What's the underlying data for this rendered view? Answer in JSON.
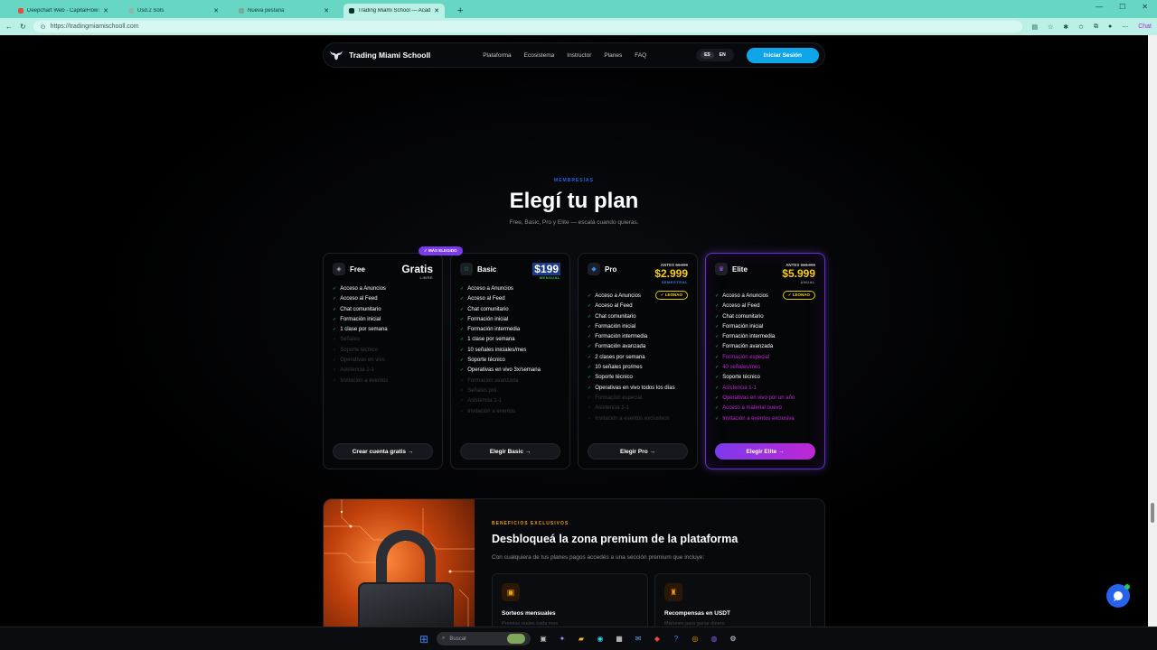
{
  "browser": {
    "tabs": [
      {
        "title": "Deepchart Web - CapitalFlowTrading",
        "active": false,
        "color": "#e74c3c"
      },
      {
        "title": "Usd.2 Sots",
        "active": false,
        "color": "#8fb7b0"
      },
      {
        "title": "Nueva pestaña",
        "active": false,
        "color": "#7ea6a0"
      },
      {
        "title": "Trading Miami School — Academ...",
        "active": true,
        "color": "#0b2e29"
      }
    ],
    "new_tab": "+",
    "url": "https://tradingmiamischooll.com",
    "profile": "Chat"
  },
  "site": {
    "brand": "Trading Miami Schooll",
    "nav": [
      "Plataforma",
      "Ecosistema",
      "Instructor",
      "Planes",
      "FAQ"
    ],
    "lang_es": "ES",
    "lang_en": "EN",
    "login": "Iniciar Sesión"
  },
  "plans_section": {
    "eyebrow": "MEMBRESÍAS",
    "title": "Elegí tu plan",
    "subtitle": "Free, Basic, Pro y Elite — escalá cuando quieras.",
    "ribbon": "✓ MÁS ELEGIDO"
  },
  "plans": [
    {
      "name": "Free",
      "icon": "◈",
      "price": "Gratis",
      "note": "LIBRE",
      "cta": "Crear cuenta gratis →",
      "features": [
        {
          "t": "Acceso a Anuncios",
          "s": "on"
        },
        {
          "t": "Acceso al Feed",
          "s": "on"
        },
        {
          "t": "Chat comunitario",
          "s": "on"
        },
        {
          "t": "Formación inicial",
          "s": "on"
        },
        {
          "t": "1 clase por semana",
          "s": "on"
        },
        {
          "t": "Señales",
          "s": "off"
        },
        {
          "t": "Soporte técnico",
          "s": "off"
        },
        {
          "t": "Operativas en vivo",
          "s": "off"
        },
        {
          "t": "Asistencia 1-1",
          "s": "off"
        },
        {
          "t": "Invitación a eventos",
          "s": "off"
        }
      ]
    },
    {
      "name": "Basic",
      "icon": "☆",
      "price": "$199",
      "note": "MENSUAL",
      "cta": "Elegir Basic →",
      "features": [
        {
          "t": "Acceso a Anuncios",
          "s": "on"
        },
        {
          "t": "Acceso al Feed",
          "s": "on"
        },
        {
          "t": "Chat comunitario",
          "s": "on"
        },
        {
          "t": "Formación inicial",
          "s": "on"
        },
        {
          "t": "Formación intermedia",
          "s": "on"
        },
        {
          "t": "1 clase por semana",
          "s": "on"
        },
        {
          "t": "10 señales iniciales/mes",
          "s": "on"
        },
        {
          "t": "Soporte técnico",
          "s": "on"
        },
        {
          "t": "Operativas en vivo 3x/semana",
          "s": "on"
        },
        {
          "t": "Formación avanzada",
          "s": "off"
        },
        {
          "t": "Señales pro",
          "s": "off"
        },
        {
          "t": "Asistencia 1-1",
          "s": "off"
        },
        {
          "t": "Invitación a eventos",
          "s": "off"
        }
      ]
    },
    {
      "name": "Pro",
      "icon": "◆",
      "was_label": "ANTES",
      "was": "$5.000",
      "price": "$2.999",
      "note": "SEMESTRAL",
      "badge": "✓ LEONAO",
      "cta": "Elegir Pro →",
      "features": [
        {
          "t": "Acceso a Anuncios",
          "s": "on"
        },
        {
          "t": "Acceso al Feed",
          "s": "on"
        },
        {
          "t": "Chat comunitario",
          "s": "on"
        },
        {
          "t": "Formación inicial",
          "s": "on"
        },
        {
          "t": "Formación intermedia",
          "s": "on"
        },
        {
          "t": "Formación avanzada",
          "s": "on"
        },
        {
          "t": "2 clases por semana",
          "s": "on"
        },
        {
          "t": "10 señales pro/mes",
          "s": "on"
        },
        {
          "t": "Soporte técnico",
          "s": "on"
        },
        {
          "t": "Operativas en vivo todos los días",
          "s": "on"
        },
        {
          "t": "Formación especial",
          "s": "off"
        },
        {
          "t": "Asistencia 1-1",
          "s": "off"
        },
        {
          "t": "Invitación a eventos exclusivos",
          "s": "off"
        }
      ]
    },
    {
      "name": "Elite",
      "icon": "♛",
      "was_label": "ANTES",
      "was": "$10.000",
      "price": "$5.999",
      "note": "ANUAL",
      "badge": "✓ LEONAO",
      "cta": "Elegir Elite →",
      "features": [
        {
          "t": "Acceso a Anuncios",
          "s": "on"
        },
        {
          "t": "Acceso al Feed",
          "s": "on"
        },
        {
          "t": "Chat comunitario",
          "s": "on"
        },
        {
          "t": "Formación inicial",
          "s": "on"
        },
        {
          "t": "Formación intermedia",
          "s": "on"
        },
        {
          "t": "Formación avanzada",
          "s": "on"
        },
        {
          "t": "Formación especial",
          "s": "hl"
        },
        {
          "t": "40 señales/mes",
          "s": "hl"
        },
        {
          "t": "Soporte técnico",
          "s": "on"
        },
        {
          "t": "Asistencia 1-1",
          "s": "hl"
        },
        {
          "t": "Operativas en vivo por un año",
          "s": "hl"
        },
        {
          "t": "Acceso a material nuevo",
          "s": "hl"
        },
        {
          "t": "Invitación a eventos exclusiva",
          "s": "hl"
        }
      ]
    }
  ],
  "premium": {
    "eyebrow": "BENEFICIOS EXCLUSIVOS",
    "title": "Desbloqueá la zona premium de la plataforma",
    "subtitle": "Con cualquiera de tus planes pagos accedés a una sección premium que incluye:",
    "cards": [
      {
        "icon": "▣",
        "title": "Sorteos mensuales",
        "sub": "Premios reales cada mes"
      },
      {
        "icon": "♜",
        "title": "Recompensas en USDT",
        "sub": "Misiones para ganar dinero"
      }
    ]
  },
  "taskbar": {
    "search": "Buscar"
  }
}
